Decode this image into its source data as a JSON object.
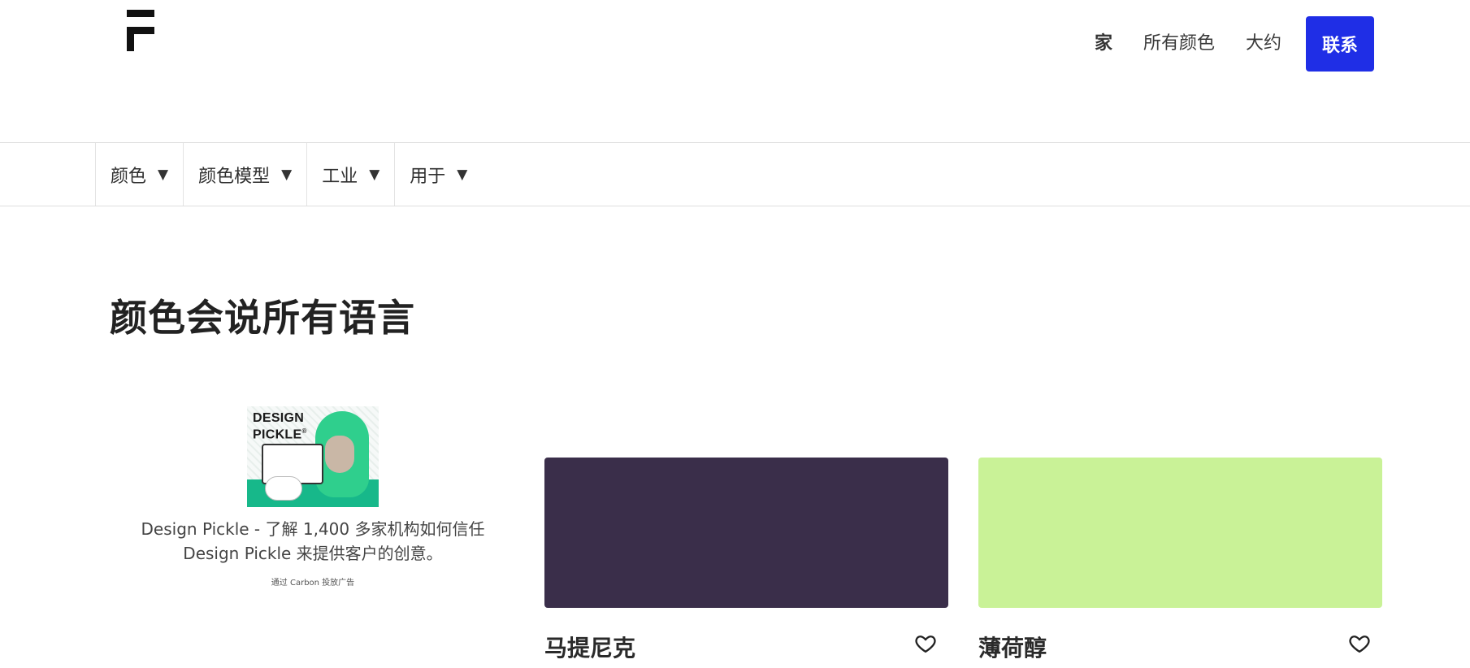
{
  "header": {
    "logo_name": "logo",
    "nav": [
      {
        "label": "家",
        "active": true
      },
      {
        "label": "所有颜色",
        "active": false
      },
      {
        "label": "大约",
        "active": false
      }
    ],
    "contact_label": "联系",
    "accent_color": "#1f2ee6"
  },
  "filters": [
    {
      "label": "颜色",
      "caret": "▼"
    },
    {
      "label": "颜色模型",
      "caret": "▼"
    },
    {
      "label": "工业",
      "caret": "▼"
    },
    {
      "label": "用于",
      "caret": "▼"
    }
  ],
  "main": {
    "title": "颜色会说所有语言"
  },
  "ad": {
    "image_brand": "DESIGN\nPICKLE",
    "text": "Design Pickle - 了解 1,400 多家机构如何信任 Design Pickle 来提供客户的创意。",
    "via": "通过 Carbon 投放广告"
  },
  "colors": [
    {
      "name": "马提尼克",
      "swatch": "#3a2e4a"
    },
    {
      "name": "薄荷醇",
      "swatch": "#c9f297"
    }
  ]
}
